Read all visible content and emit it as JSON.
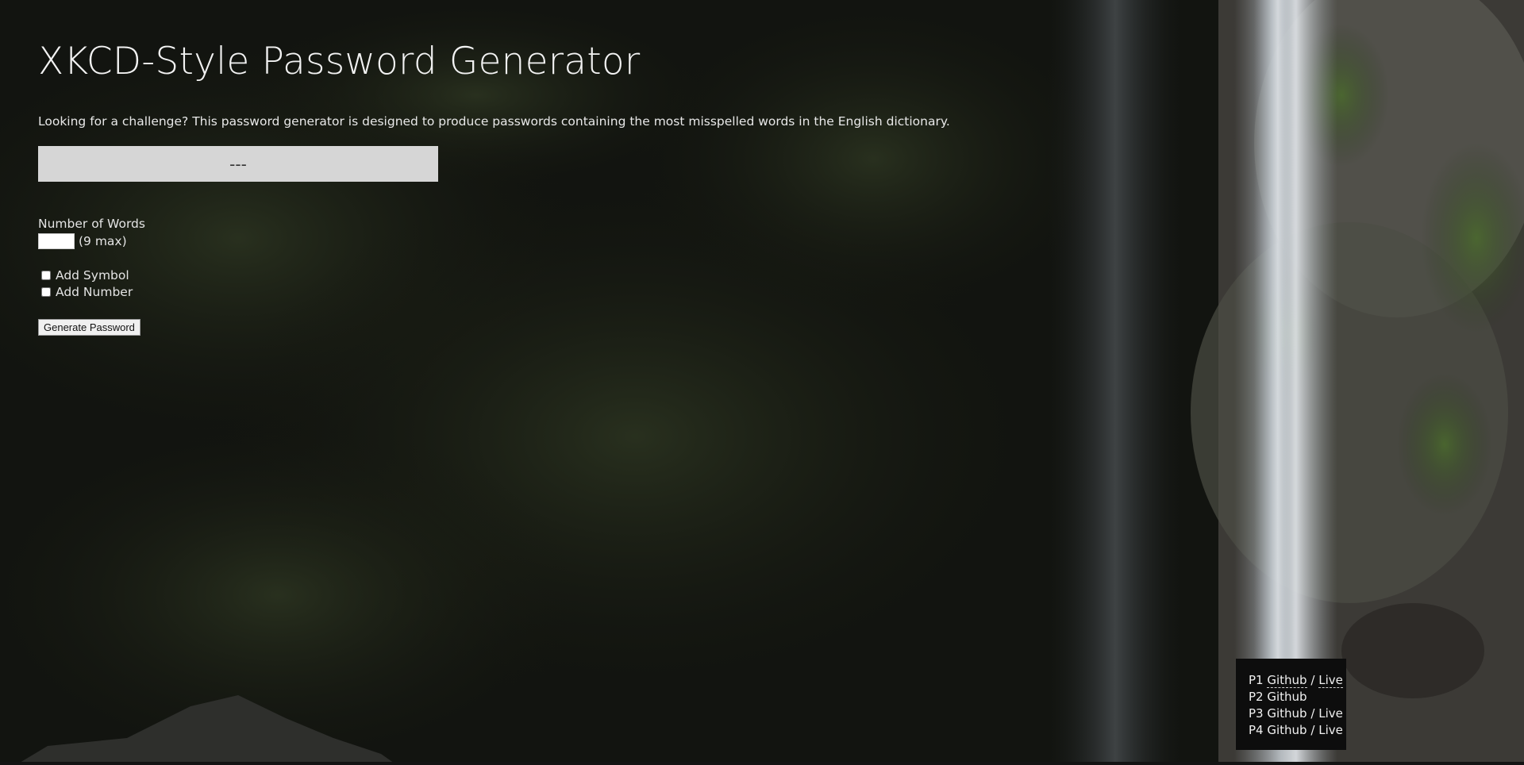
{
  "page": {
    "title": "XKCD-Style Password Generator",
    "intro": "Looking for a challenge? This password generator is designed to produce passwords containing the most misspelled words in the English dictionary."
  },
  "password": {
    "display": "---"
  },
  "form": {
    "words_label": "Number of Words",
    "words_value": "",
    "words_max_hint": "(9 max)",
    "symbol_label": "Add Symbol",
    "symbol_checked": false,
    "number_label": "Add Number",
    "number_checked": false,
    "generate_label": "Generate Password"
  },
  "projects": [
    {
      "prefix": "P1",
      "github": "Github",
      "sep": "/",
      "live": "Live"
    },
    {
      "prefix": "P2",
      "github": "Github"
    },
    {
      "prefix": "P3",
      "github": "Github",
      "sep": "/",
      "live": "Live"
    },
    {
      "prefix": "P4",
      "github": "Github",
      "sep": "/",
      "live": "Live"
    }
  ],
  "colors": {
    "background_dark": "#0f110d",
    "password_box": "#d6d6d6",
    "projects_panel": "#0d0d0d",
    "text_light": "#f2f2f2"
  }
}
